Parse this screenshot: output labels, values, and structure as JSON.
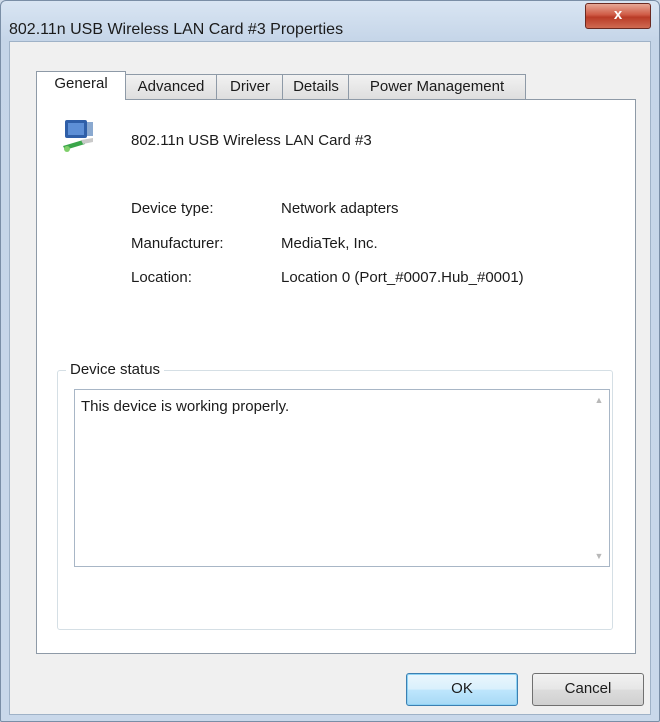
{
  "window": {
    "title": "802.11n USB Wireless LAN Card #3 Properties",
    "close_label": "x"
  },
  "tabs": [
    {
      "label": "General",
      "active": true
    },
    {
      "label": "Advanced",
      "active": false
    },
    {
      "label": "Driver",
      "active": false
    },
    {
      "label": "Details",
      "active": false
    },
    {
      "label": "Power Management",
      "active": false
    }
  ],
  "device": {
    "name": "802.11n USB Wireless LAN Card #3",
    "icon": "network-adapter-icon",
    "properties": [
      {
        "label": "Device type:",
        "value": "Network adapters"
      },
      {
        "label": "Manufacturer:",
        "value": "MediaTek, Inc."
      },
      {
        "label": "Location:",
        "value": "Location 0 (Port_#0007.Hub_#0001)"
      }
    ]
  },
  "status": {
    "group_label": "Device status",
    "text": "This device is working properly."
  },
  "buttons": {
    "ok": "OK",
    "cancel": "Cancel"
  },
  "colors": {
    "close_button": "#c8503c",
    "default_button_border": "#3c7fb1"
  }
}
